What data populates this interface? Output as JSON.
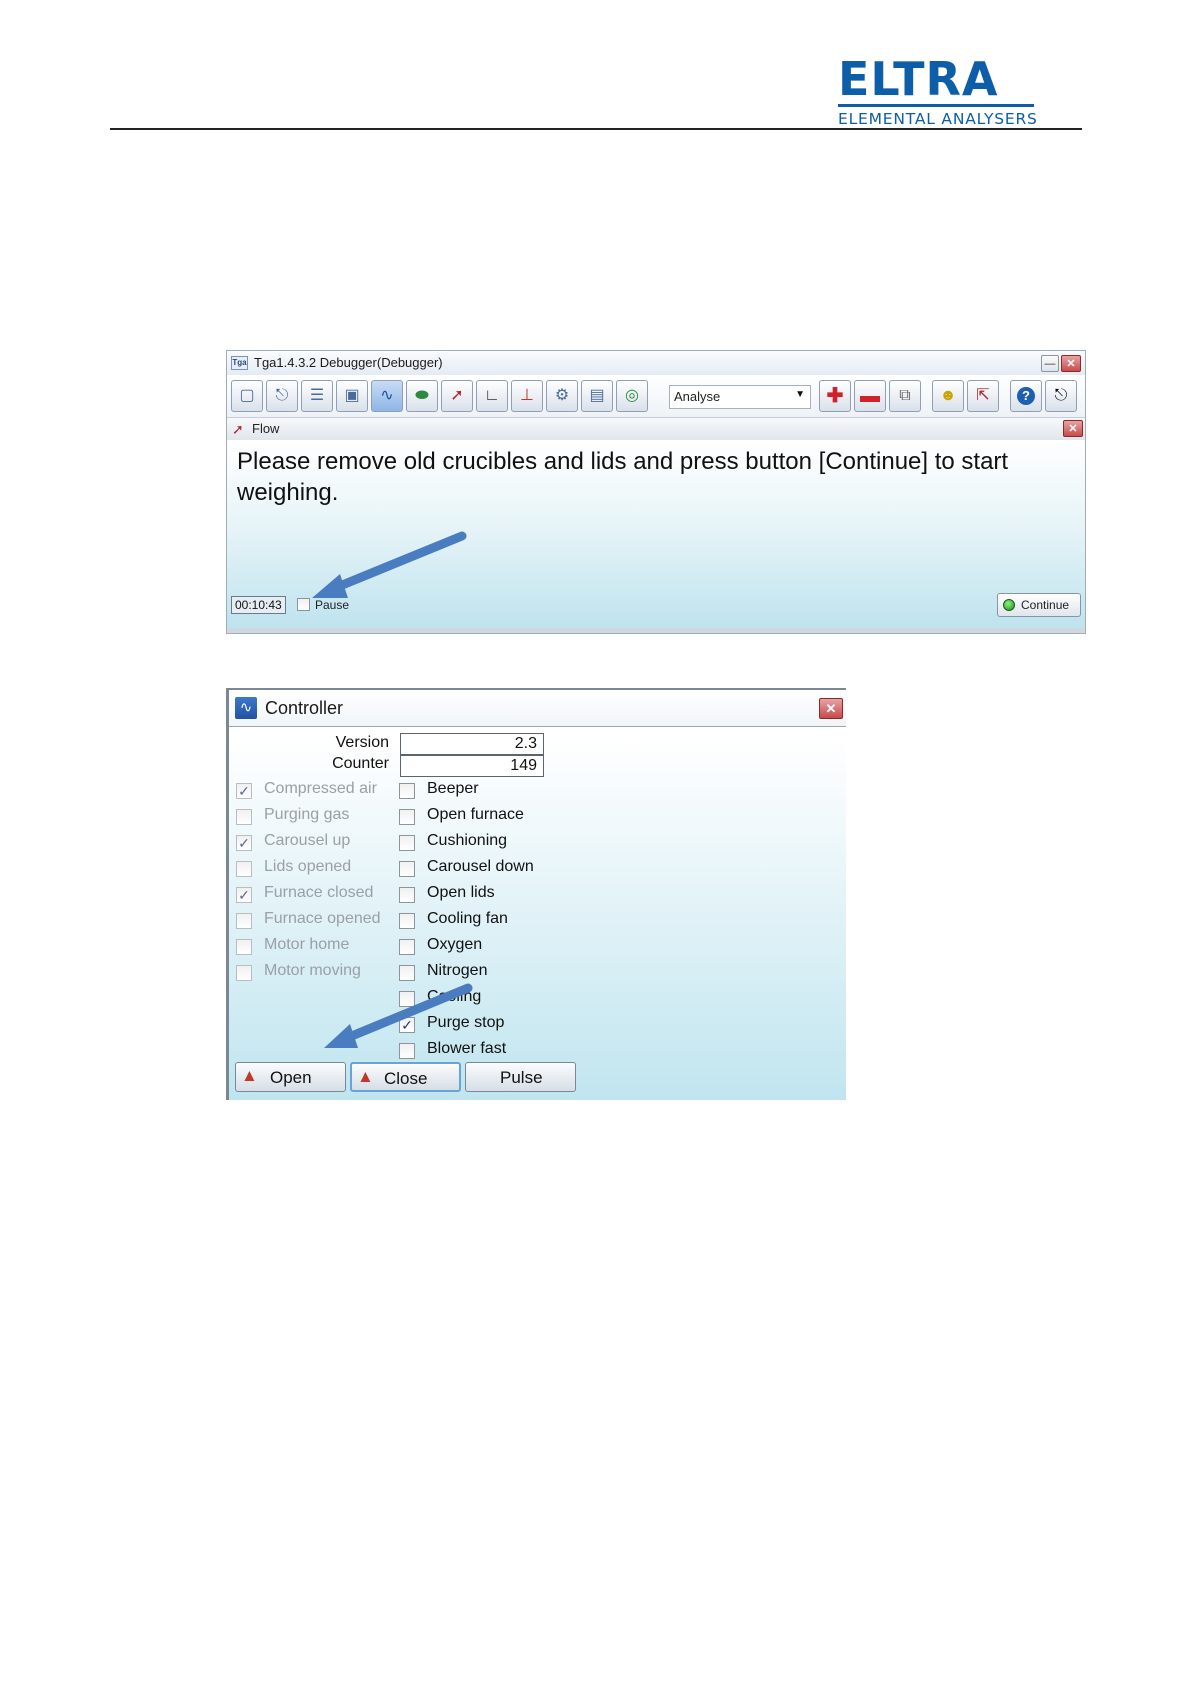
{
  "logo": {
    "word": "ELTRA",
    "subtitle": "ELEMENTAL ANALYSERS"
  },
  "colors": {
    "brand": "#0d5ea8",
    "arrow": "#4a7dc0"
  },
  "tga_window": {
    "app_icon_text": "Tga",
    "title": "Tga1.4.3.2 Debugger(Debugger)",
    "mode_select": "Analyse",
    "toolbar_icons": [
      "new-icon",
      "save-icon",
      "list-icon",
      "image-icon",
      "controller-icon",
      "oval-icon",
      "flow-icon",
      "chart-icon",
      "thermometer-icon",
      "settings-icon",
      "report-icon",
      "target-icon"
    ],
    "flow": {
      "title": "Flow",
      "message": "Please remove old crucibles and lids and press button [Continue] to start weighing.",
      "timer": "00:10:43",
      "pause_label": "Pause",
      "pause_checked": false,
      "continue_label": "Continue"
    }
  },
  "controller_window": {
    "title": "Controller",
    "version_label": "Version",
    "version_value": "2.3",
    "counter_label": "Counter",
    "counter_value": "149",
    "status_inputs": [
      {
        "label": "Compressed air",
        "checked": true
      },
      {
        "label": "Purging gas",
        "checked": false
      },
      {
        "label": "Carousel up",
        "checked": true
      },
      {
        "label": "Lids opened",
        "checked": false
      },
      {
        "label": "Furnace closed",
        "checked": true
      },
      {
        "label": "Furnace opened",
        "checked": false
      },
      {
        "label": "Motor home",
        "checked": false
      },
      {
        "label": "Motor moving",
        "checked": false
      }
    ],
    "outputs": [
      {
        "label": "Beeper",
        "checked": false
      },
      {
        "label": "Open furnace",
        "checked": false
      },
      {
        "label": "Cushioning",
        "checked": false
      },
      {
        "label": "Carousel down",
        "checked": false
      },
      {
        "label": "Open lids",
        "checked": false
      },
      {
        "label": "Cooling fan",
        "checked": false
      },
      {
        "label": "Oxygen",
        "checked": false
      },
      {
        "label": "Nitrogen",
        "checked": false
      },
      {
        "label": "Cooling",
        "checked": false
      },
      {
        "label": "Purge stop",
        "checked": true
      },
      {
        "label": "Blower fast",
        "checked": false
      }
    ],
    "buttons": {
      "open": "Open",
      "close": "Close",
      "pulse": "Pulse"
    }
  }
}
